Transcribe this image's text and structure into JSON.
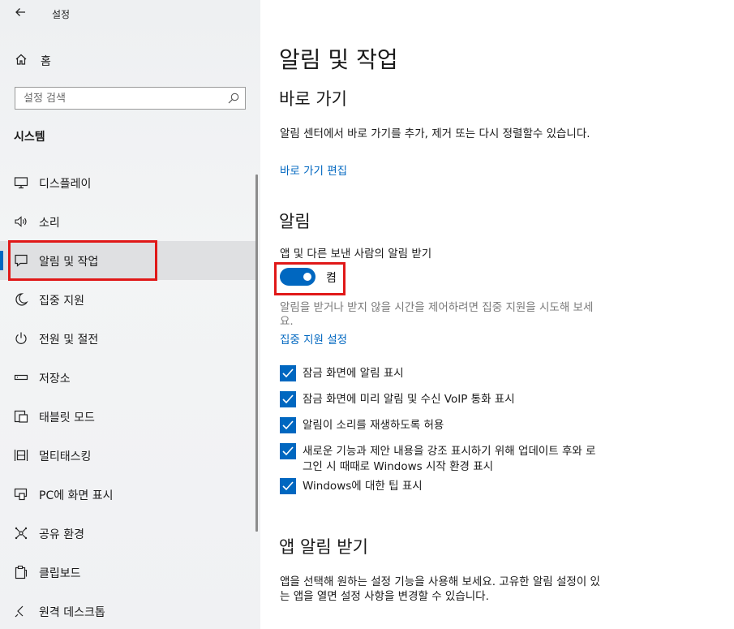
{
  "window": {
    "title": "설정"
  },
  "sidebar": {
    "home_label": "홈",
    "search_placeholder": "설정 검색",
    "section_title": "시스템",
    "items": [
      {
        "label": "디스플레이",
        "icon": "monitor-icon"
      },
      {
        "label": "소리",
        "icon": "speaker-icon"
      },
      {
        "label": "알림 및 작업",
        "icon": "notification-icon",
        "active": true
      },
      {
        "label": "집중 지원",
        "icon": "moon-icon"
      },
      {
        "label": "전원 및 절전",
        "icon": "power-icon"
      },
      {
        "label": "저장소",
        "icon": "storage-icon"
      },
      {
        "label": "태블릿 모드",
        "icon": "tablet-icon"
      },
      {
        "label": "멀티태스킹",
        "icon": "multitasking-icon"
      },
      {
        "label": "PC에 화면 표시",
        "icon": "projecting-icon"
      },
      {
        "label": "공유 환경",
        "icon": "shared-experiences-icon"
      },
      {
        "label": "클립보드",
        "icon": "clipboard-icon"
      },
      {
        "label": "원격 데스크톱",
        "icon": "remote-desktop-icon"
      }
    ]
  },
  "main": {
    "page_title": "알림 및 작업",
    "quick_actions": {
      "heading": "바로 가기",
      "description": "알림 센터에서 바로 가기를 추가, 제거 또는 다시 정렬할수 있습니다.",
      "edit_link": "바로 가기 편집"
    },
    "notifications": {
      "heading": "알림",
      "toggle_caption": "앱 및 다른 보낸 사람의 알림 받기",
      "toggle_state": "켬",
      "toggle_on": true,
      "focus_hint_line1": "알림을 받거나 받지 않을 시간을 제어하려면 집중 지원을 시도해 보세",
      "focus_hint_line2": "요.",
      "focus_link": "집중 지원 설정",
      "checkboxes": [
        {
          "line1": "잠금 화면에 알림 표시",
          "line2": "",
          "checked": true
        },
        {
          "line1": "잠금 화면에 미리 알림 및 수신 VoIP 통화 표시",
          "line2": "",
          "checked": true
        },
        {
          "line1": "알림이 소리를 재생하도록 허용",
          "line2": "",
          "checked": true
        },
        {
          "line1": "새로운 기능과 제안 내용을 강조 표시하기 위해 업데이트 후와 로",
          "line2": "그인 시 때때로 Windows 시작 환경 표시",
          "checked": true
        },
        {
          "line1": "Windows에 대한 팁 표시",
          "line2": "",
          "checked": true
        }
      ]
    },
    "app_notifications": {
      "heading": "앱 알림 받기",
      "description_line1": "앱을 선택해 원하는 설정 기능을 사용해 보세요. 고유한 알림 설정이 있",
      "description_line2": "는 앱을 열면 설정 사항을 변경할 수 있습니다."
    }
  },
  "colors": {
    "accent": "#0067c0",
    "highlight": "#e01818",
    "sidebar_bg": "#f0f1f3"
  }
}
